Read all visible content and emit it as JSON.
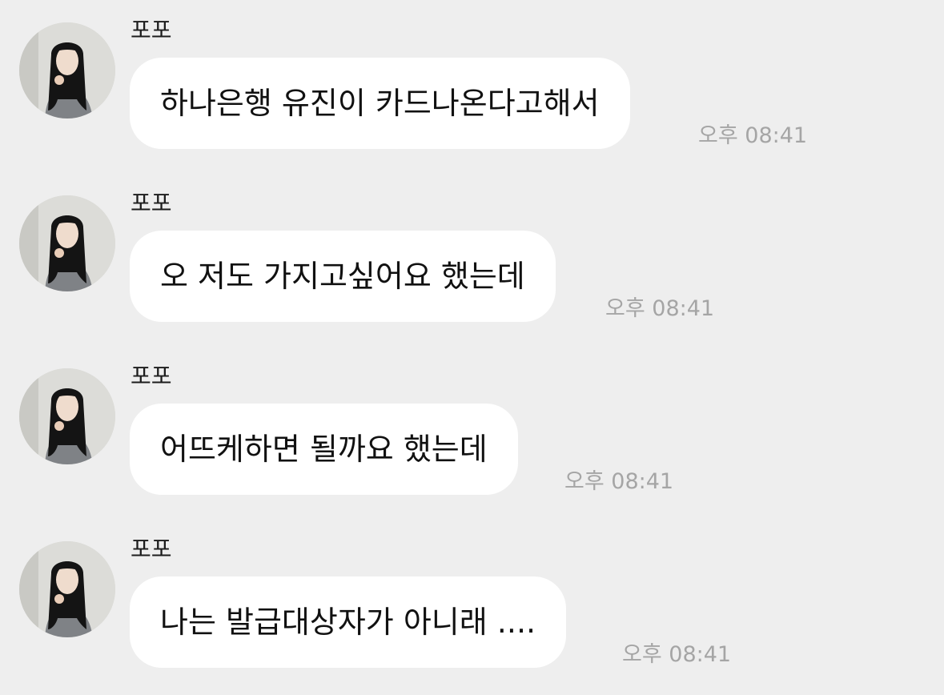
{
  "messages": [
    {
      "sender": "포포",
      "text": "하나은행 유진이 카드나온다고해서",
      "time": "오후 08:41"
    },
    {
      "sender": "포포",
      "text": "오 저도 가지고싶어요 했는데",
      "time": "오후 08:41"
    },
    {
      "sender": "포포",
      "text": "어뜨케하면 될까요 했는데",
      "time": "오후 08:41"
    },
    {
      "sender": "포포",
      "text": "나는 발급대상자가 아니래 ....",
      "time": "오후 08:41"
    }
  ],
  "colors": {
    "background": "#eeeeee",
    "bubble": "#ffffff",
    "timestamp": "#a5a5a5"
  },
  "icons": {
    "avatar": "profile-photo"
  }
}
